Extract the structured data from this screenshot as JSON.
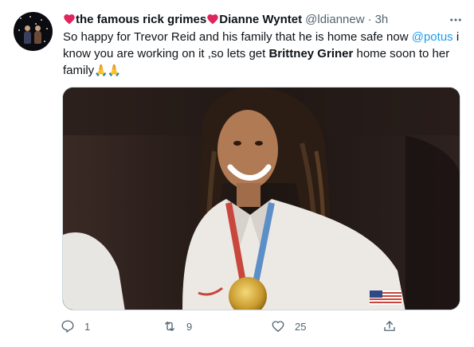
{
  "tweet": {
    "display_name": "the famous rick grimes",
    "display_name_suffix": "Dianne Wyntet",
    "handle": "@ldiannew",
    "separator": "·",
    "time": "3h",
    "text": {
      "part1": "So happy for Trevor Reid and his family that he is home safe now ",
      "mention": "@potus",
      "part2": " i know you are working on it ,so lets get ",
      "bold": "Brittney Griner",
      "part3": " home soon to her family",
      "emoji": "🙏🙏"
    },
    "media_image": "photo of smiling athlete with long locs wearing a white team jacket and a gold medal",
    "actions": {
      "reply_count": "1",
      "retweet_count": "9",
      "like_count": "25"
    }
  },
  "icons": {
    "heart": "heart-icon",
    "more": "more-icon",
    "reply": "reply-icon",
    "retweet": "retweet-icon",
    "like": "like-icon",
    "share": "share-icon"
  },
  "colors": {
    "heart": "#e0245e",
    "mention": "#1d9bf0",
    "muted": "#536471"
  }
}
